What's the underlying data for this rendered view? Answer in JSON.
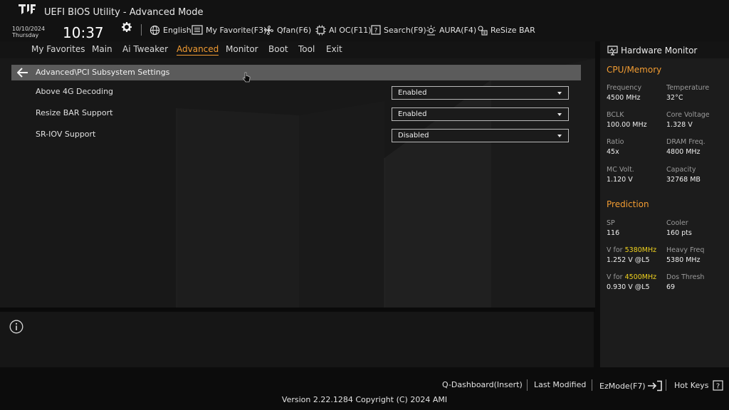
{
  "header": {
    "title": "UEFI BIOS Utility - Advanced Mode",
    "date": "10/10/2024",
    "day": "Thursday",
    "time": "10:37",
    "buttons": {
      "language": "English",
      "favorite": "My Favorite(F3)",
      "qfan": "Qfan(F6)",
      "aioc": "AI OC(F11)",
      "search": "Search(F9)",
      "aura": "AURA(F4)",
      "resize_bar": "ReSize BAR"
    }
  },
  "menu": {
    "items": [
      "My Favorites",
      "Main",
      "Ai Tweaker",
      "Advanced",
      "Monitor",
      "Boot",
      "Tool",
      "Exit"
    ],
    "active": "Advanced"
  },
  "main": {
    "breadcrumb": "Advanced\\PCI Subsystem Settings",
    "settings": [
      {
        "label": "Above 4G Decoding",
        "value": "Enabled"
      },
      {
        "label": "Resize BAR Support",
        "value": "Enabled"
      },
      {
        "label": "SR-IOV Support",
        "value": "Disabled"
      }
    ]
  },
  "hardware_monitor": {
    "title": "Hardware Monitor",
    "cpu_memory": {
      "title": "CPU/Memory",
      "items": [
        {
          "label": "Frequency",
          "value": "4500 MHz"
        },
        {
          "label": "Temperature",
          "value": "32°C"
        },
        {
          "label": "BCLK",
          "value": "100.00 MHz"
        },
        {
          "label": "Core Voltage",
          "value": "1.328 V"
        },
        {
          "label": "Ratio",
          "value": "45x"
        },
        {
          "label": "DRAM Freq.",
          "value": "4800 MHz"
        },
        {
          "label": "MC Volt.",
          "value": "1.120 V"
        },
        {
          "label": "Capacity",
          "value": "32768 MB"
        }
      ]
    },
    "prediction": {
      "title": "Prediction",
      "sp_label": "SP",
      "sp_value": "116",
      "cooler_label": "Cooler",
      "cooler_value": "160 pts",
      "vfor_prefix": "V for ",
      "vfor1_freq": "5380MHz",
      "vfor1_value": "1.252 V @L5",
      "heavy_label": "Heavy Freq",
      "heavy_value": "5380 MHz",
      "vfor2_freq": "4500MHz",
      "vfor2_value": "0.930 V @L5",
      "dos_label": "Dos Thresh",
      "dos_value": "69"
    },
    "highlight_color": "#f0d21e",
    "accent_color": "#f29c32"
  },
  "footer": {
    "qdashboard": "Q-Dashboard(Insert)",
    "last_modified": "Last Modified",
    "ezmode": "EzMode(F7)",
    "hotkeys": "Hot Keys",
    "version": "Version 2.22.1284 Copyright (C) 2024 AMI"
  }
}
